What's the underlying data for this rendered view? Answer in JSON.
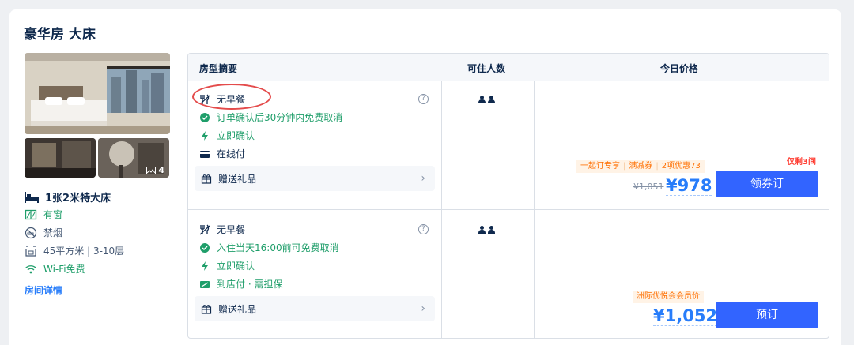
{
  "room": {
    "title": "豪华房 大床",
    "photo_count": "4",
    "bed": "1张2米特大床",
    "facilities": [
      "有窗",
      "禁烟",
      "45平方米 | 3-10层",
      "Wi-Fi免费"
    ],
    "detail_link": "房间详情"
  },
  "table": {
    "headers": [
      "房型摘要",
      "可住人数",
      "今日价格"
    ],
    "rows": [
      {
        "meal": "无早餐",
        "cancel": "订单确认后30分钟内免费取消",
        "confirm": "立即确认",
        "payment": "在线付",
        "gift": "赠送礼品",
        "promo": [
          "一起订专享",
          "满减券",
          "2项优惠73"
        ],
        "old_price": "¥1,051",
        "price": "¥978",
        "rooms_left": "仅剩3间",
        "button": "领券订"
      },
      {
        "meal": "无早餐",
        "cancel": "入住当天16:00前可免费取消",
        "confirm": "立即确认",
        "payment": "到店付 · 需担保",
        "gift": "赠送礼品",
        "promo": [
          "洲际优悦会会员价"
        ],
        "price": "¥1,052",
        "button": "预订"
      }
    ]
  },
  "colors": {
    "accent": "#3264ff",
    "price": "#287dfa",
    "green": "#1f9e6a",
    "promo": "#ff6f00",
    "alert": "#ff3b30"
  }
}
